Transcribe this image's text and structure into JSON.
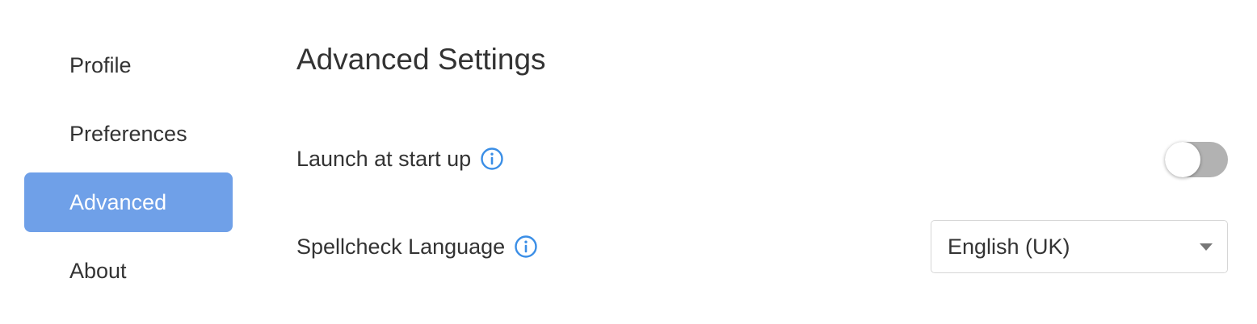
{
  "sidebar": {
    "items": [
      {
        "label": "Profile",
        "active": false
      },
      {
        "label": "Preferences",
        "active": false
      },
      {
        "label": "Advanced",
        "active": true
      },
      {
        "label": "About",
        "active": false
      }
    ]
  },
  "main": {
    "title": "Advanced Settings",
    "launch_at_startup": {
      "label": "Launch at start up",
      "enabled": false
    },
    "spellcheck": {
      "label": "Spellcheck Language",
      "selected": "English (UK)"
    }
  },
  "colors": {
    "active_nav_bg": "#6fa0e8",
    "info_icon": "#3a8ee6",
    "toggle_off_track": "#b2b2b2",
    "text": "#333333"
  },
  "icons": {
    "info": "info-icon",
    "dropdown": "chevron-down-icon"
  }
}
